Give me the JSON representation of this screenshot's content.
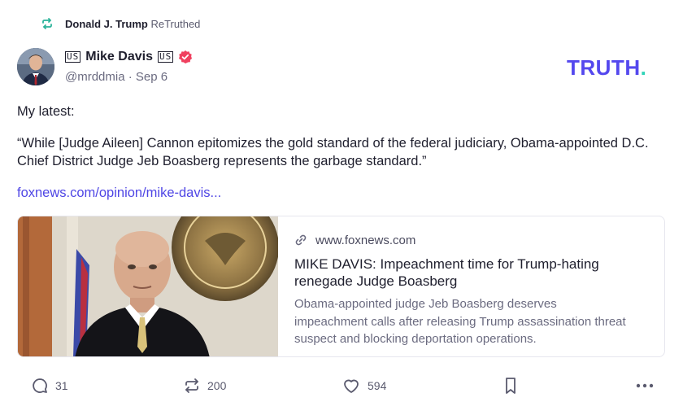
{
  "retruth": {
    "author": "Donald J. Trump",
    "action": "ReTruthed",
    "icon": "retruth-icon"
  },
  "post": {
    "flag_left": "US",
    "display_name": "Mike Davis",
    "flag_right": "US",
    "verified_icon": "verified-badge-icon",
    "handle": "@mrddmia",
    "separator": "·",
    "date": "Sep 6",
    "paragraph1": "My latest:",
    "paragraph2": "“While [Judge Aileen] Cannon epitomizes the gold standard of the federal judiciary, Obama-appointed D.C. Chief District Judge Jeb Boasberg represents the garbage standard.”",
    "link_text": "foxnews.com/opinion/mike-davis..."
  },
  "logo": {
    "text": "TRUTH",
    "dot": ".",
    "brand_color": "#5448ee",
    "dot_color": "#2ed3b7"
  },
  "card": {
    "domain": "www.foxnews.com",
    "title": "MIKE DAVIS: Impeachment time for Trump-hating renegade Judge Boasberg",
    "description": "Obama-appointed judge Jeb Boasberg deserves impeachment calls after releasing Trump assassination threat suspect and blocking deportation operations.",
    "link_icon": "link-icon"
  },
  "actions": {
    "replies": "31",
    "retruths": "200",
    "likes": "594"
  },
  "colors": {
    "accent": "#4f46e5",
    "text": "#1f1f2e",
    "muted": "#6b6b80",
    "verified": "#f0405f"
  }
}
